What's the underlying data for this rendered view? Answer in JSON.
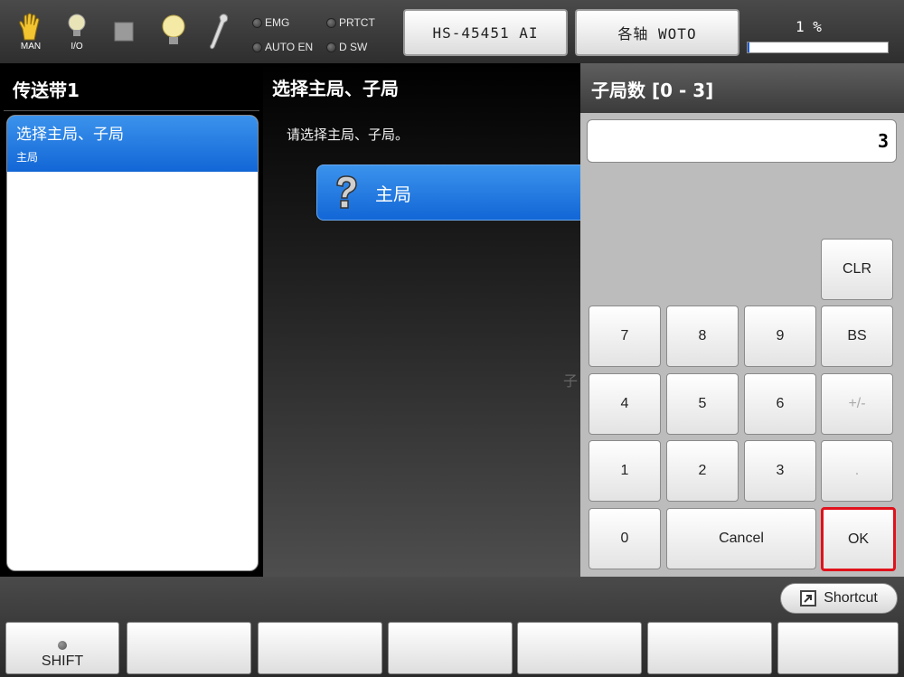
{
  "topbar": {
    "icons": [
      {
        "name": "hand-icon",
        "caption": "MAN"
      },
      {
        "name": "bulb-icon",
        "caption": "I/O"
      },
      {
        "name": "square-icon",
        "caption": ""
      },
      {
        "name": "lamp-icon",
        "caption": ""
      },
      {
        "name": "wrench-icon",
        "caption": ""
      }
    ],
    "status": {
      "emg": "EMG",
      "prtct": "PRTCT",
      "auto_en": "AUTO EN",
      "dsw": "D SW"
    },
    "robot_button": "HS-45451 AI",
    "axis_button": "各轴 WOTO",
    "speed_text": "1 %",
    "speed_value": 1
  },
  "left": {
    "title": "传送带1",
    "items": [
      {
        "label": "选择主局、子局",
        "sub": "主局"
      }
    ]
  },
  "middle": {
    "title": "选择主局、子局",
    "instruction": "请选择主局、子局。",
    "choice_label": "主局",
    "ghost_text": "子"
  },
  "keypad": {
    "title": "子局数 [0 - 3]",
    "display_value": "3",
    "keys": {
      "clr": "CLR",
      "k7": "7",
      "k8": "8",
      "k9": "9",
      "bs": "BS",
      "k4": "4",
      "k5": "5",
      "k6": "6",
      "sign": "+/-",
      "k1": "1",
      "k2": "2",
      "k3": "3",
      "dot": ".",
      "k0": "0",
      "cancel": "Cancel",
      "ok": "OK"
    }
  },
  "bottom": {
    "shortcut": "Shortcut",
    "shift": "SHIFT"
  },
  "colors": {
    "accent": "#1a6fdc",
    "ok_border": "#e0121c"
  }
}
